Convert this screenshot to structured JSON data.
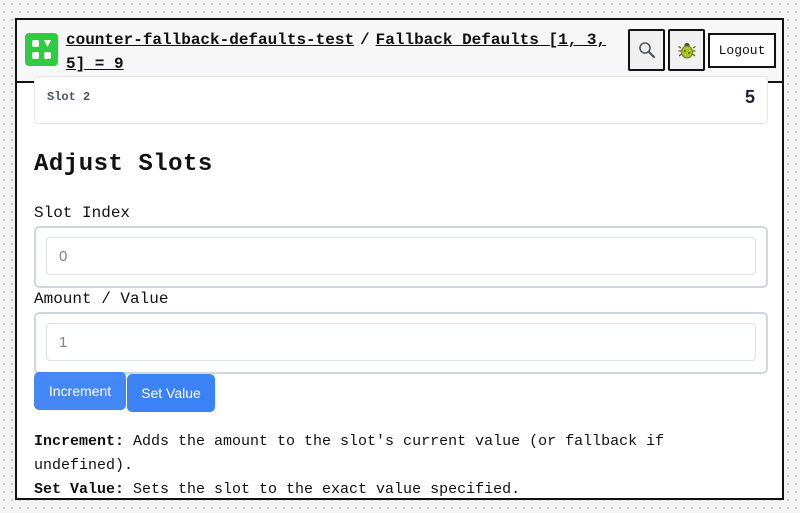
{
  "header": {
    "app_link": "counter-fallback-defaults-test",
    "separator": "/",
    "page_link": "Fallback Defaults [1, 3, 5] = 9",
    "logout_label": "Logout",
    "icons": {
      "search": "magnifier-icon",
      "bug": "bug-icon",
      "logo": "app-logo-icon"
    }
  },
  "slot": {
    "label": "Slot 2",
    "value": "5"
  },
  "adjust": {
    "title": "Adjust Slots",
    "index_label": "Slot Index",
    "index_placeholder": "0",
    "amount_label": "Amount / Value",
    "amount_placeholder": "1",
    "increment_label": "Increment",
    "set_label": "Set Value"
  },
  "help": {
    "increment_term": "Increment:",
    "increment_text": " Adds the amount to the slot's current value (or fallback if undefined).",
    "set_term": "Set Value:",
    "set_text": " Sets the slot to the exact value specified."
  },
  "colors": {
    "accent": "#3b82f6",
    "logo": "#2ecc40"
  }
}
